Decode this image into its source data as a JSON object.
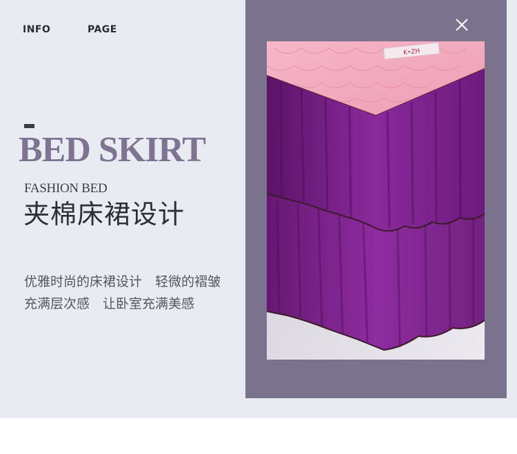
{
  "nav": {
    "info": "INFO",
    "page": "PAGE"
  },
  "hero": {
    "title": "BED SKIRT",
    "subtitle_en": "FASHION BED",
    "subtitle_cn": "夹棉床裙设计"
  },
  "description": {
    "line1": "优雅时尚的床裙设计　轻微的褶皱",
    "line2": "充满层次感　让卧室充满美感"
  },
  "product_label": "K•ZH",
  "icons": {
    "close": "close-icon"
  },
  "colors": {
    "panel_bg": "#e9ebf2",
    "frame_bg": "#7b738d",
    "title_accent": "#7e7491",
    "skirt_purple": "#7d1f8e",
    "quilt_pink": "#f2a8bd"
  }
}
